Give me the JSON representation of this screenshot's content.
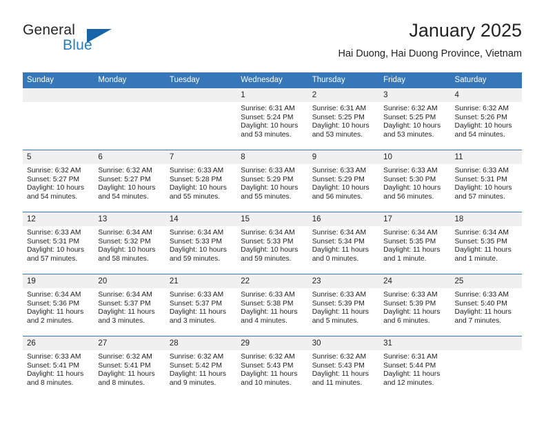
{
  "brand": {
    "name_part1": "General",
    "name_part2": "Blue",
    "triangle_color": "#1565a8",
    "accent_color": "#1f7ec4"
  },
  "header": {
    "title": "January 2025",
    "subtitle": "Hai Duong, Hai Duong Province, Vietnam"
  },
  "calendar": {
    "header_bg": "#3577b8",
    "daynum_bg": "#f0f0f0",
    "weekdays": [
      "Sunday",
      "Monday",
      "Tuesday",
      "Wednesday",
      "Thursday",
      "Friday",
      "Saturday"
    ],
    "weeks": [
      [
        {
          "day": "",
          "sunrise": "",
          "sunset": "",
          "daylight_line1": "",
          "daylight_line2": ""
        },
        {
          "day": "",
          "sunrise": "",
          "sunset": "",
          "daylight_line1": "",
          "daylight_line2": ""
        },
        {
          "day": "",
          "sunrise": "",
          "sunset": "",
          "daylight_line1": "",
          "daylight_line2": ""
        },
        {
          "day": "1",
          "sunrise": "Sunrise: 6:31 AM",
          "sunset": "Sunset: 5:24 PM",
          "daylight_line1": "Daylight: 10 hours",
          "daylight_line2": "and 53 minutes."
        },
        {
          "day": "2",
          "sunrise": "Sunrise: 6:31 AM",
          "sunset": "Sunset: 5:25 PM",
          "daylight_line1": "Daylight: 10 hours",
          "daylight_line2": "and 53 minutes."
        },
        {
          "day": "3",
          "sunrise": "Sunrise: 6:32 AM",
          "sunset": "Sunset: 5:25 PM",
          "daylight_line1": "Daylight: 10 hours",
          "daylight_line2": "and 53 minutes."
        },
        {
          "day": "4",
          "sunrise": "Sunrise: 6:32 AM",
          "sunset": "Sunset: 5:26 PM",
          "daylight_line1": "Daylight: 10 hours",
          "daylight_line2": "and 54 minutes."
        }
      ],
      [
        {
          "day": "5",
          "sunrise": "Sunrise: 6:32 AM",
          "sunset": "Sunset: 5:27 PM",
          "daylight_line1": "Daylight: 10 hours",
          "daylight_line2": "and 54 minutes."
        },
        {
          "day": "6",
          "sunrise": "Sunrise: 6:32 AM",
          "sunset": "Sunset: 5:27 PM",
          "daylight_line1": "Daylight: 10 hours",
          "daylight_line2": "and 54 minutes."
        },
        {
          "day": "7",
          "sunrise": "Sunrise: 6:33 AM",
          "sunset": "Sunset: 5:28 PM",
          "daylight_line1": "Daylight: 10 hours",
          "daylight_line2": "and 55 minutes."
        },
        {
          "day": "8",
          "sunrise": "Sunrise: 6:33 AM",
          "sunset": "Sunset: 5:29 PM",
          "daylight_line1": "Daylight: 10 hours",
          "daylight_line2": "and 55 minutes."
        },
        {
          "day": "9",
          "sunrise": "Sunrise: 6:33 AM",
          "sunset": "Sunset: 5:29 PM",
          "daylight_line1": "Daylight: 10 hours",
          "daylight_line2": "and 56 minutes."
        },
        {
          "day": "10",
          "sunrise": "Sunrise: 6:33 AM",
          "sunset": "Sunset: 5:30 PM",
          "daylight_line1": "Daylight: 10 hours",
          "daylight_line2": "and 56 minutes."
        },
        {
          "day": "11",
          "sunrise": "Sunrise: 6:33 AM",
          "sunset": "Sunset: 5:31 PM",
          "daylight_line1": "Daylight: 10 hours",
          "daylight_line2": "and 57 minutes."
        }
      ],
      [
        {
          "day": "12",
          "sunrise": "Sunrise: 6:33 AM",
          "sunset": "Sunset: 5:31 PM",
          "daylight_line1": "Daylight: 10 hours",
          "daylight_line2": "and 57 minutes."
        },
        {
          "day": "13",
          "sunrise": "Sunrise: 6:34 AM",
          "sunset": "Sunset: 5:32 PM",
          "daylight_line1": "Daylight: 10 hours",
          "daylight_line2": "and 58 minutes."
        },
        {
          "day": "14",
          "sunrise": "Sunrise: 6:34 AM",
          "sunset": "Sunset: 5:33 PM",
          "daylight_line1": "Daylight: 10 hours",
          "daylight_line2": "and 59 minutes."
        },
        {
          "day": "15",
          "sunrise": "Sunrise: 6:34 AM",
          "sunset": "Sunset: 5:33 PM",
          "daylight_line1": "Daylight: 10 hours",
          "daylight_line2": "and 59 minutes."
        },
        {
          "day": "16",
          "sunrise": "Sunrise: 6:34 AM",
          "sunset": "Sunset: 5:34 PM",
          "daylight_line1": "Daylight: 11 hours",
          "daylight_line2": "and 0 minutes."
        },
        {
          "day": "17",
          "sunrise": "Sunrise: 6:34 AM",
          "sunset": "Sunset: 5:35 PM",
          "daylight_line1": "Daylight: 11 hours",
          "daylight_line2": "and 1 minute."
        },
        {
          "day": "18",
          "sunrise": "Sunrise: 6:34 AM",
          "sunset": "Sunset: 5:35 PM",
          "daylight_line1": "Daylight: 11 hours",
          "daylight_line2": "and 1 minute."
        }
      ],
      [
        {
          "day": "19",
          "sunrise": "Sunrise: 6:34 AM",
          "sunset": "Sunset: 5:36 PM",
          "daylight_line1": "Daylight: 11 hours",
          "daylight_line2": "and 2 minutes."
        },
        {
          "day": "20",
          "sunrise": "Sunrise: 6:34 AM",
          "sunset": "Sunset: 5:37 PM",
          "daylight_line1": "Daylight: 11 hours",
          "daylight_line2": "and 3 minutes."
        },
        {
          "day": "21",
          "sunrise": "Sunrise: 6:33 AM",
          "sunset": "Sunset: 5:37 PM",
          "daylight_line1": "Daylight: 11 hours",
          "daylight_line2": "and 3 minutes."
        },
        {
          "day": "22",
          "sunrise": "Sunrise: 6:33 AM",
          "sunset": "Sunset: 5:38 PM",
          "daylight_line1": "Daylight: 11 hours",
          "daylight_line2": "and 4 minutes."
        },
        {
          "day": "23",
          "sunrise": "Sunrise: 6:33 AM",
          "sunset": "Sunset: 5:39 PM",
          "daylight_line1": "Daylight: 11 hours",
          "daylight_line2": "and 5 minutes."
        },
        {
          "day": "24",
          "sunrise": "Sunrise: 6:33 AM",
          "sunset": "Sunset: 5:39 PM",
          "daylight_line1": "Daylight: 11 hours",
          "daylight_line2": "and 6 minutes."
        },
        {
          "day": "25",
          "sunrise": "Sunrise: 6:33 AM",
          "sunset": "Sunset: 5:40 PM",
          "daylight_line1": "Daylight: 11 hours",
          "daylight_line2": "and 7 minutes."
        }
      ],
      [
        {
          "day": "26",
          "sunrise": "Sunrise: 6:33 AM",
          "sunset": "Sunset: 5:41 PM",
          "daylight_line1": "Daylight: 11 hours",
          "daylight_line2": "and 8 minutes."
        },
        {
          "day": "27",
          "sunrise": "Sunrise: 6:32 AM",
          "sunset": "Sunset: 5:41 PM",
          "daylight_line1": "Daylight: 11 hours",
          "daylight_line2": "and 8 minutes."
        },
        {
          "day": "28",
          "sunrise": "Sunrise: 6:32 AM",
          "sunset": "Sunset: 5:42 PM",
          "daylight_line1": "Daylight: 11 hours",
          "daylight_line2": "and 9 minutes."
        },
        {
          "day": "29",
          "sunrise": "Sunrise: 6:32 AM",
          "sunset": "Sunset: 5:43 PM",
          "daylight_line1": "Daylight: 11 hours",
          "daylight_line2": "and 10 minutes."
        },
        {
          "day": "30",
          "sunrise": "Sunrise: 6:32 AM",
          "sunset": "Sunset: 5:43 PM",
          "daylight_line1": "Daylight: 11 hours",
          "daylight_line2": "and 11 minutes."
        },
        {
          "day": "31",
          "sunrise": "Sunrise: 6:31 AM",
          "sunset": "Sunset: 5:44 PM",
          "daylight_line1": "Daylight: 11 hours",
          "daylight_line2": "and 12 minutes."
        },
        {
          "day": "",
          "sunrise": "",
          "sunset": "",
          "daylight_line1": "",
          "daylight_line2": ""
        }
      ]
    ]
  }
}
